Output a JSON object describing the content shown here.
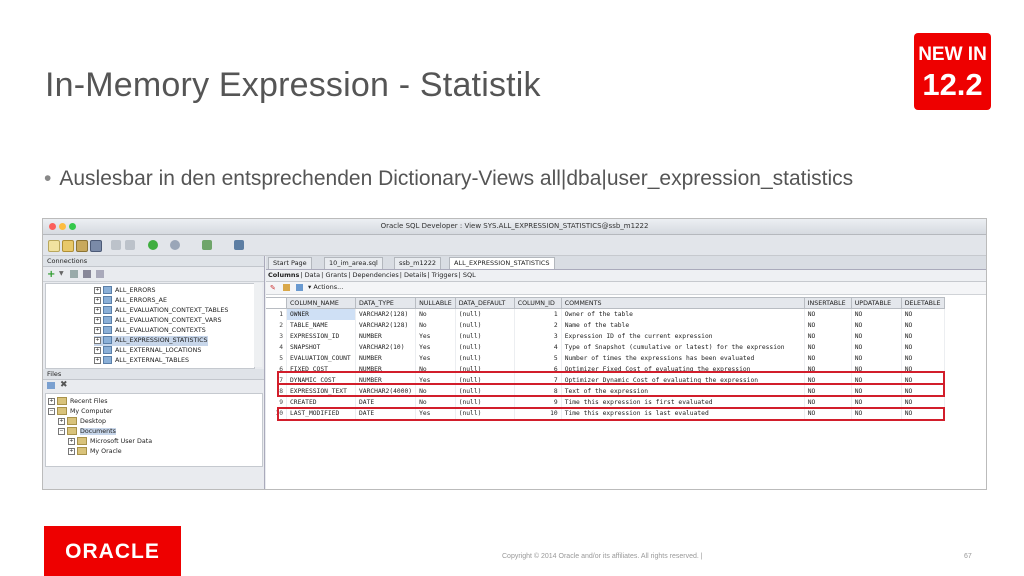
{
  "slide": {
    "title": "In-Memory Expression - Statistik",
    "badge_line1": "NEW IN",
    "badge_line2": "12.2",
    "bullet": "Auslesbar in den entsprechenden Dictionary-Views all|dba|user_expression_statistics",
    "oracle_logo": "ORACLE",
    "copyright": "Copyright © 2014 Oracle and/or its affiliates. All rights reserved.  |",
    "page_number": "67"
  },
  "window": {
    "title": "Oracle SQL Developer : View SYS.ALL_EXPRESSION_STATISTICS@ssb_m1222",
    "traffic_colors": [
      "#fc605c",
      "#fdbc40",
      "#34c84a"
    ]
  },
  "connections": {
    "header": "Connections",
    "items": [
      "ALL_ERRORS",
      "ALL_ERRORS_AE",
      "ALL_EVALUATION_CONTEXT_TABLES",
      "ALL_EVALUATION_CONTEXT_VARS",
      "ALL_EVALUATION_CONTEXTS",
      "ALL_EXPRESSION_STATISTICS",
      "ALL_EXTERNAL_LOCATIONS",
      "ALL_EXTERNAL_TABLES"
    ],
    "selected_index": 5
  },
  "files": {
    "header": "Files",
    "items": [
      "Recent Files",
      "My Computer",
      "Desktop",
      "Documents",
      "Microsoft User Data",
      "My Oracle"
    ]
  },
  "doc_tabs": [
    "Start Page",
    "10_im_area.sql",
    "ssb_m1222",
    "ALL_EXPRESSION_STATISTICS"
  ],
  "sub_tabs": [
    "Columns",
    "Data",
    "Grants",
    "Dependencies",
    "Details",
    "Triggers",
    "SQL"
  ],
  "actions_label": "Actions...",
  "grid": {
    "headers": [
      "COLUMN_NAME",
      "DATA_TYPE",
      "NULLABLE",
      "DATA_DEFAULT",
      "COLUMN_ID",
      "COMMENTS",
      "INSERTABLE",
      "UPDATABLE",
      "DELETABLE"
    ],
    "rows": [
      [
        "1",
        "OWNER",
        "VARCHAR2(128)",
        "No",
        "(null)",
        "1",
        "Owner of the table",
        "NO",
        "NO",
        "NO"
      ],
      [
        "2",
        "TABLE_NAME",
        "VARCHAR2(128)",
        "No",
        "(null)",
        "2",
        "Name of the table",
        "NO",
        "NO",
        "NO"
      ],
      [
        "3",
        "EXPRESSION_ID",
        "NUMBER",
        "Yes",
        "(null)",
        "3",
        "Expression ID of the current expression",
        "NO",
        "NO",
        "NO"
      ],
      [
        "4",
        "SNAPSHOT",
        "VARCHAR2(10)",
        "Yes",
        "(null)",
        "4",
        "Type of Snapshot (cumulative or latest) for the expression",
        "NO",
        "NO",
        "NO"
      ],
      [
        "5",
        "EVALUATION_COUNT",
        "NUMBER",
        "Yes",
        "(null)",
        "5",
        "Number of times the expressions has been evaluated",
        "NO",
        "NO",
        "NO"
      ],
      [
        "6",
        "FIXED_COST",
        "NUMBER",
        "No",
        "(null)",
        "6",
        "Optimizer Fixed Cost of evaluating the expression",
        "NO",
        "NO",
        "NO"
      ],
      [
        "7",
        "DYNAMIC_COST",
        "NUMBER",
        "Yes",
        "(null)",
        "7",
        "Optimizer Dynamic Cost of evaluating the expression",
        "NO",
        "NO",
        "NO"
      ],
      [
        "8",
        "EXPRESSION_TEXT",
        "VARCHAR2(4000)",
        "No",
        "(null)",
        "8",
        "Text of the expression",
        "NO",
        "NO",
        "NO"
      ],
      [
        "9",
        "CREATED",
        "DATE",
        "No",
        "(null)",
        "9",
        "Time this expression is first evaluated",
        "NO",
        "NO",
        "NO"
      ],
      [
        "10",
        "LAST_MODIFIED",
        "DATE",
        "Yes",
        "(null)",
        "10",
        "Time this expression is last evaluated",
        "NO",
        "NO",
        "NO"
      ]
    ]
  },
  "colors": {
    "oracle_red": "#ee0000",
    "highlight_red": "#d21e2b"
  }
}
